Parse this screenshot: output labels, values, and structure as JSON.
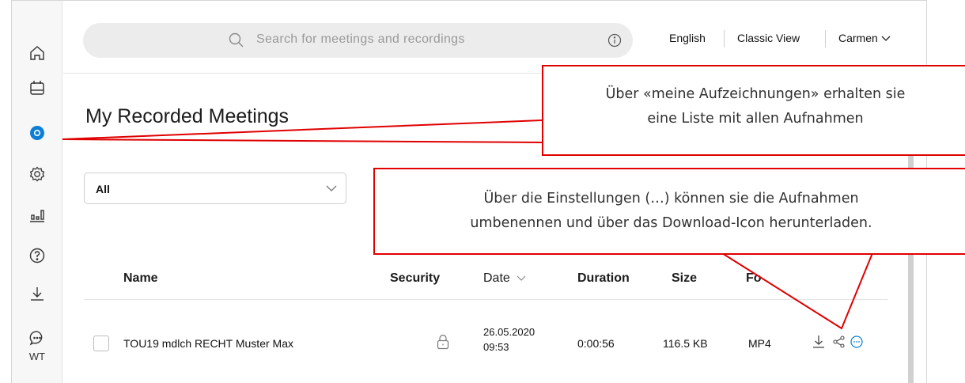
{
  "search": {
    "placeholder": "Search for meetings and recordings"
  },
  "header": {
    "language": "English",
    "classic_view": "Classic View",
    "user": "Carmen"
  },
  "sidebar": {
    "bottom_label": "WT"
  },
  "main": {
    "title": "My Recorded Meetings",
    "filter": {
      "selected": "All"
    },
    "table": {
      "columns": {
        "name": "Name",
        "security": "Security",
        "date": "Date",
        "duration": "Duration",
        "size": "Size",
        "format": "Fo"
      },
      "rows": [
        {
          "name": "TOU19 mdlch RECHT Muster Max",
          "date_line1": "26.05.2020",
          "date_line2": "09:53",
          "duration": "0:00:56",
          "size": "116.5 KB",
          "format": "MP4"
        }
      ]
    }
  },
  "callouts": {
    "recordings": {
      "line1": "Über «meine Aufzeichnungen» erhalten sie",
      "line2": "eine Liste mit allen Aufnahmen"
    },
    "settings": {
      "line1": "Über die Einstellungen (…) können sie die Aufnahmen",
      "line2": "umbenennen und über das Download-Icon herunterladen."
    }
  },
  "colors": {
    "accent": "#0d7fd6",
    "annotation": "#e00000"
  },
  "icons": [
    "home-icon",
    "calendar-icon",
    "recordings-icon",
    "gear-icon",
    "insights-icon",
    "help-icon",
    "download-icon",
    "chat-icon",
    "search-icon",
    "info-icon",
    "chevron-down-icon",
    "lock-icon",
    "share-icon",
    "more-icon"
  ]
}
